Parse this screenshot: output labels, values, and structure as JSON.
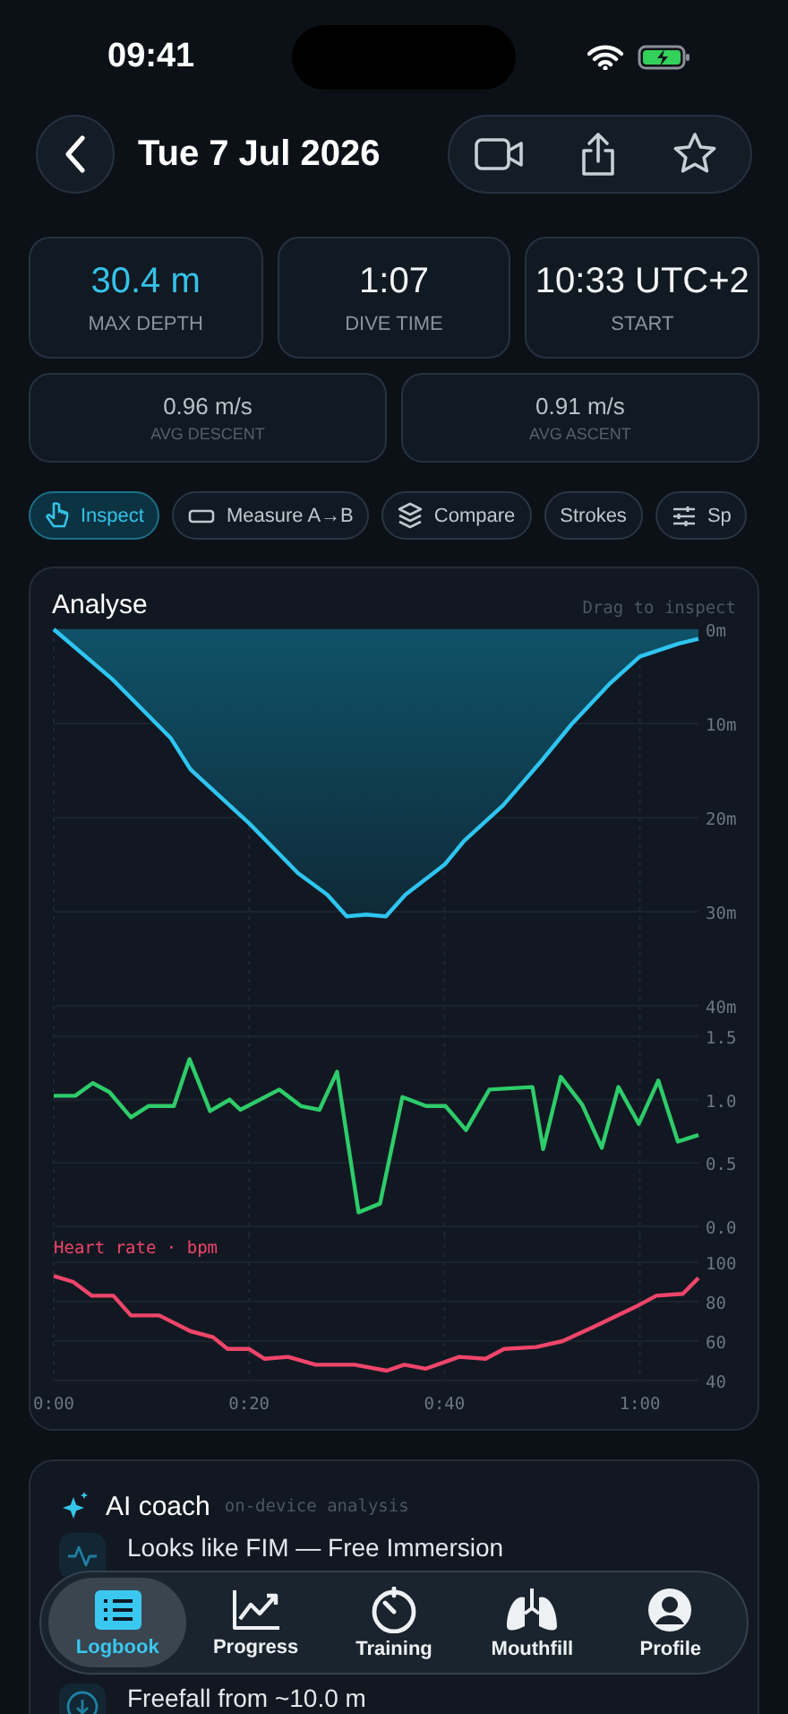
{
  "status_bar": {
    "time": "09:41"
  },
  "header": {
    "title": "Tue 7 Jul 2026"
  },
  "stats": [
    {
      "value": "30.4 m",
      "label": "MAX DEPTH",
      "kind": "accent"
    },
    {
      "value": "1:07",
      "label": "DIVE TIME",
      "kind": "plain"
    },
    {
      "value": "10:33 UTC+2",
      "label": "START",
      "kind": "plain"
    },
    {
      "value": "0.96 m/s",
      "label": "AVG DESCENT",
      "kind": "small"
    },
    {
      "value": "0.91 m/s",
      "label": "AVG ASCENT",
      "kind": "small"
    }
  ],
  "tools": [
    {
      "label": "Inspect",
      "kind": "hand",
      "selected": true
    },
    {
      "label": "Measure A→B",
      "kind": "ruler",
      "selected": false
    },
    {
      "label": "Compare",
      "kind": "layers",
      "selected": false
    },
    {
      "label": "Strokes",
      "kind": "none",
      "selected": false
    },
    {
      "label": "Sp",
      "kind": "sliders",
      "selected": false
    }
  ],
  "analyse": {
    "title": "Analyse",
    "hint": "Drag to inspect",
    "depth": {
      "chart_data": {
        "type": "area",
        "grid": true,
        "xlim": [
          0,
          66
        ],
        "ylim": [
          40,
          0
        ],
        "yticks": [
          {
            "value": 0,
            "label": "0m"
          },
          {
            "value": 10,
            "label": "10m"
          },
          {
            "value": 20,
            "label": "20m"
          },
          {
            "value": 30,
            "label": "30m"
          },
          {
            "value": 40,
            "label": "40m"
          }
        ],
        "x": [
          0,
          6,
          12,
          14,
          20,
          25,
          28,
          30,
          32,
          34,
          36,
          40,
          42,
          46,
          50,
          53,
          57,
          60,
          64,
          66
        ],
        "series": [
          {
            "color": "#2ec5f0",
            "values": [
              0,
              5.3,
              11.6,
              14.9,
              20.6,
              25.9,
              28.2,
              30.5,
              30.3,
              30.5,
              28.2,
              25,
              22.5,
              18.7,
              13.9,
              10.1,
              5.7,
              2.9,
              1.5,
              1
            ]
          }
        ]
      }
    },
    "speed": {
      "chart_data": {
        "type": "line",
        "grid": true,
        "xlim": [
          0,
          66
        ],
        "ylim": [
          0,
          1.5
        ],
        "yticks": [
          {
            "value": 0,
            "label": "0.0"
          },
          {
            "value": 0.5,
            "label": "0.5"
          },
          {
            "value": 1,
            "label": "1.0"
          },
          {
            "value": 1.5,
            "label": "1.5"
          }
        ],
        "x": [
          0,
          2.2,
          4,
          5.7,
          7.9,
          9.7,
          12.3,
          13.9,
          16,
          18,
          19.1,
          23.1,
          25.3,
          27.2,
          29,
          31.2,
          33.4,
          35.7,
          38.1,
          40.1,
          42.2,
          44.6,
          49,
          50.1,
          51.9,
          54.1,
          56.1,
          57.8,
          59.9,
          61.9,
          63.9,
          66
        ],
        "series": [
          {
            "color": "#2ecc6a",
            "values": [
              1.03,
              1.03,
              1.13,
              1.06,
              0.86,
              0.95,
              0.95,
              1.32,
              0.91,
              1.0,
              0.92,
              1.08,
              0.95,
              0.92,
              1.22,
              0.11,
              0.18,
              1.02,
              0.95,
              0.95,
              0.76,
              1.08,
              1.1,
              0.61,
              1.18,
              0.96,
              0.62,
              1.1,
              0.81,
              1.15,
              0.67,
              0.72
            ]
          }
        ]
      }
    },
    "heart": {
      "chart_data": {
        "type": "line",
        "grid": true,
        "title": "Heart rate · bpm",
        "xlim": [
          0,
          66
        ],
        "ylim": [
          40,
          100
        ],
        "yticks": [
          40,
          60,
          80,
          100
        ],
        "xticks": [
          {
            "value": 0,
            "label": "0:00"
          },
          {
            "value": 20,
            "label": "0:20"
          },
          {
            "value": 40,
            "label": "0:40"
          },
          {
            "value": 60,
            "label": "1:00"
          }
        ],
        "x": [
          0,
          2,
          3.9,
          6.1,
          7.9,
          10.8,
          14,
          16.3,
          17.8,
          20,
          21.6,
          24,
          26.8,
          30.8,
          34.1,
          35.9,
          38.1,
          41.5,
          44.2,
          46.1,
          49.4,
          52.1,
          55.2,
          59.8,
          61.7,
          64.4,
          66
        ],
        "series": [
          {
            "color": "#f0456a",
            "values": [
              93,
              90,
              83,
              83,
              73,
              73,
              65,
              62,
              56,
              56,
              51,
              52,
              48,
              48,
              45,
              48,
              46,
              52,
              51,
              56,
              57,
              60,
              67,
              78,
              83,
              84,
              92
            ]
          }
        ]
      }
    }
  },
  "coach": {
    "title": "AI coach",
    "subtitle": "on-device analysis",
    "insights": [
      {
        "kind": "pulse",
        "title": "Looks like FIM — Free Immersion"
      },
      {
        "kind": "down",
        "title": "Freefall from ~10.0 m"
      }
    ]
  },
  "tab_bar": [
    {
      "label": "Logbook",
      "kind": "list",
      "selected": true
    },
    {
      "label": "Progress",
      "kind": "chart",
      "selected": false
    },
    {
      "label": "Training",
      "kind": "timer",
      "selected": false
    },
    {
      "label": "Mouthfill",
      "kind": "lungs",
      "selected": false
    },
    {
      "label": "Profile",
      "kind": "person",
      "selected": false
    }
  ]
}
